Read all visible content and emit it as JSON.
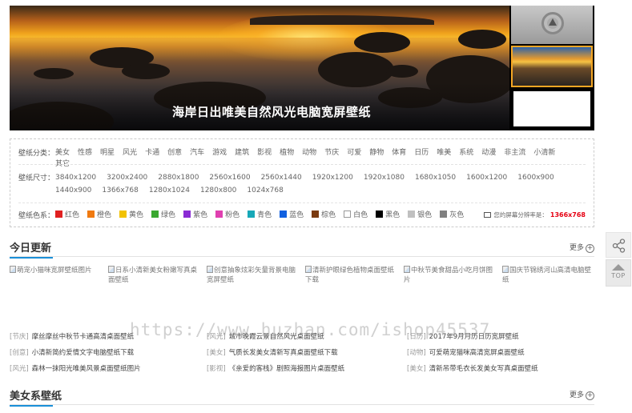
{
  "banner": {
    "title": "海岸日出唯美自然风光电脑宽屏壁纸"
  },
  "filter": {
    "category_label": "壁纸分类：",
    "categories": [
      "美女",
      "性感",
      "明星",
      "风光",
      "卡通",
      "创意",
      "汽车",
      "游戏",
      "建筑",
      "影视",
      "植物",
      "动物",
      "节庆",
      "可爱",
      "静物",
      "体育",
      "日历",
      "唯美",
      "系统",
      "动漫",
      "非主流",
      "小清新",
      "其它"
    ],
    "size_label": "壁纸尺寸：",
    "sizes": [
      "3840x1200",
      "3200x2400",
      "2880x1800",
      "2560x1600",
      "2560x1440",
      "1920x1200",
      "1920x1080",
      "1680x1050",
      "1600x1200",
      "1600x900",
      "1440x900",
      "1366x768",
      "1280x1024",
      "1280x800",
      "1024x768"
    ],
    "color_label": "壁纸色系：",
    "colors": [
      {
        "name": "红色",
        "hex": "#e02020"
      },
      {
        "name": "橙色",
        "hex": "#f07a10"
      },
      {
        "name": "黄色",
        "hex": "#f2c200"
      },
      {
        "name": "绿色",
        "hex": "#3aa830"
      },
      {
        "name": "紫色",
        "hex": "#8a2bd4"
      },
      {
        "name": "粉色",
        "hex": "#e040b0"
      },
      {
        "name": "青色",
        "hex": "#17a8b8"
      },
      {
        "name": "蓝色",
        "hex": "#1060e0"
      },
      {
        "name": "棕色",
        "hex": "#7a3a10"
      },
      {
        "name": "白色",
        "hex": "#ffffff"
      },
      {
        "name": "黑色",
        "hex": "#000000"
      },
      {
        "name": "银色",
        "hex": "#c0c0c0"
      },
      {
        "name": "灰色",
        "hex": "#808080"
      }
    ],
    "resolution_label": "您的屏幕分辨率是：",
    "resolution_value": "1366x768"
  },
  "today": {
    "title": "今日更新",
    "more": "更多",
    "images": [
      {
        "line1": "萌宠小猫咪宽屏壁纸图片",
        "line2": ""
      },
      {
        "line1": "日系小清新美女粉嫩写真桌",
        "line2": "面壁纸"
      },
      {
        "line1": "创意抽象炫彩矢量背景电脑",
        "line2": "宽屏壁纸"
      },
      {
        "line1": "清新护眼绿色植物桌面壁纸",
        "line2": "下载"
      },
      {
        "line1": "中秋节美食甜品小吃月饼图",
        "line2": "片"
      },
      {
        "line1": "国庆节锦绣河山高清电脑壁",
        "line2": "纸"
      }
    ],
    "list": [
      {
        "tag": "[节庆]",
        "text": "摩丝摩丝中秋节卡通高清桌面壁纸"
      },
      {
        "tag": "[风光]",
        "text": "城市晚霞云景自然风光桌面壁纸"
      },
      {
        "tag": "[日历]",
        "text": "2017年9月月历日历宽屏壁纸"
      },
      {
        "tag": "[创意]",
        "text": "小清新简约爱情文字电脑壁纸下载"
      },
      {
        "tag": "[美女]",
        "text": "气质长发美女清新写真桌面壁纸下载"
      },
      {
        "tag": "[动物]",
        "text": "可爱萌宠猫咪高清宽屏桌面壁纸"
      },
      {
        "tag": "[风光]",
        "text": "森林一抹阳光唯美风景桌面壁纸图片"
      },
      {
        "tag": "[影视]",
        "text": "《亲爱的客栈》剧照海报图片桌面壁纸"
      },
      {
        "tag": "[美女]",
        "text": "清新吊带毛衣长发美女写真桌面壁纸"
      }
    ]
  },
  "beauty": {
    "title": "美女系壁纸",
    "more": "更多"
  },
  "side": {
    "top_label": "TOP"
  },
  "watermark": "https://www.huzhan.com/ishop45537"
}
